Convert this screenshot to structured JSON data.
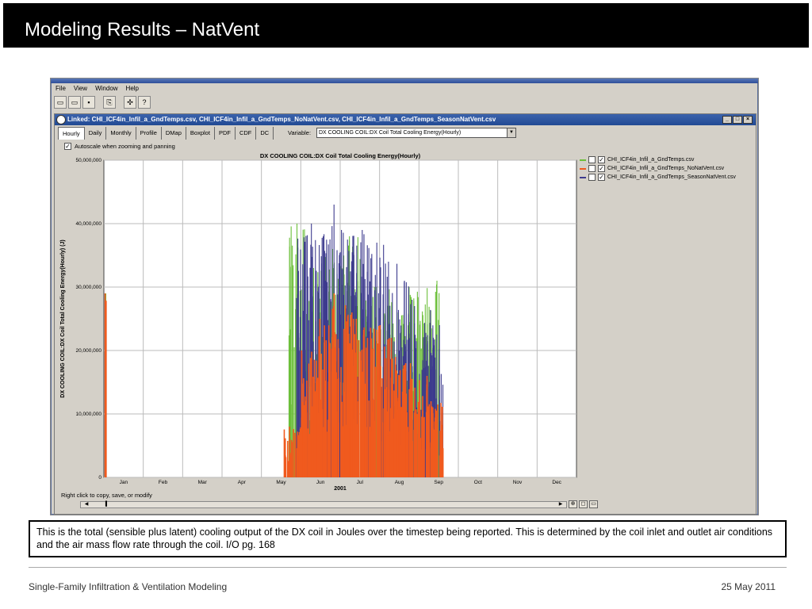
{
  "slide": {
    "title": "Modeling Results – NatVent",
    "caption": "This is the total (sensible plus latent) cooling output of the DX coil in Joules over the timestep being reported.  This is determined by the coil inlet and outlet air conditions and the air mass flow rate through the coil.  I/O pg. 168",
    "footer_left": "Single-Family Infiltration & Ventilation Modeling",
    "footer_right": "25 May 2011"
  },
  "app": {
    "menu": [
      "File",
      "View",
      "Window",
      "Help"
    ],
    "child_title": "Linked: CHI_ICF4in_Infil_a_GndTemps.csv, CHI_ICF4in_Infil_a_GndTemps_NoNatVent.csv, CHI_ICF4in_Infil_a_GndTemps_SeasonNatVent.csv",
    "window_buttons": [
      "_",
      "□",
      "×"
    ],
    "tabs": [
      "Hourly",
      "Daily",
      "Monthly",
      "Profile",
      "DMap",
      "Boxplot",
      "PDF",
      "CDF",
      "DC"
    ],
    "variable_label": "Variable:",
    "variable_value": "DX COOLING COIL:DX Coil Total Cooling Energy(Hourly)",
    "autoscale_label": "Autoscale when zooming and panning",
    "status": "Right click to copy, save, or modify"
  },
  "chart_data": {
    "type": "line",
    "title": "DX COOLING COIL:DX Coil Total Cooling Energy(Hourly)",
    "xlabel": "2001",
    "ylabel": "DX COOLING COIL:DX Coil Total Cooling Energy(Hourly) (J)",
    "x_ticks": [
      "Jan",
      "Feb",
      "Mar",
      "Apr",
      "May",
      "Jun",
      "Jul",
      "Aug",
      "Sep",
      "Oct",
      "Nov",
      "Dec"
    ],
    "y_ticks": [
      "0",
      "10,000,000",
      "20,000,000",
      "30,000,000",
      "40,000,000",
      "50,000,000"
    ],
    "ylim": [
      0,
      50000000
    ],
    "xlim_month": [
      0,
      12
    ],
    "grid": true,
    "legend_position": "right",
    "series": [
      {
        "name": "CHI_ICF4in_Infil_a_GndTemps.csv",
        "color": "#6cbf3a",
        "peaks": [
          [
            0.05,
            29000000
          ],
          [
            4.9,
            40000000
          ],
          [
            5.3,
            33000000
          ],
          [
            5.6,
            35000000
          ],
          [
            6.0,
            36000000
          ],
          [
            6.3,
            38000000
          ],
          [
            6.7,
            30000000
          ],
          [
            7.1,
            30000000
          ],
          [
            7.5,
            26000000
          ],
          [
            7.9,
            30000000
          ],
          [
            8.3,
            31000000
          ]
        ]
      },
      {
        "name": "CHI_ICF4in_Infil_a_GndTemps_NoNatVent.csv",
        "color": "#f05a1e",
        "peaks": [
          [
            0.05,
            29000000
          ],
          [
            4.8,
            8000000
          ],
          [
            5.2,
            20000000
          ],
          [
            5.6,
            25000000
          ],
          [
            6.0,
            29000000
          ],
          [
            6.4,
            26000000
          ],
          [
            6.8,
            24000000
          ],
          [
            7.2,
            22000000
          ],
          [
            7.6,
            18000000
          ],
          [
            8.0,
            16000000
          ],
          [
            8.4,
            12000000
          ]
        ]
      },
      {
        "name": "CHI_ICF4in_Infil_a_GndTemps_SeasonNatVent.csv",
        "color": "#3d3b8e",
        "peaks": [
          [
            5.1,
            40000000
          ],
          [
            5.5,
            38000000
          ],
          [
            5.8,
            43000000
          ],
          [
            6.2,
            39000000
          ],
          [
            6.5,
            39000000
          ],
          [
            6.9,
            37000000
          ],
          [
            7.3,
            34000000
          ],
          [
            7.7,
            31000000
          ],
          [
            8.1,
            27000000
          ],
          [
            8.4,
            24000000
          ]
        ]
      }
    ]
  }
}
